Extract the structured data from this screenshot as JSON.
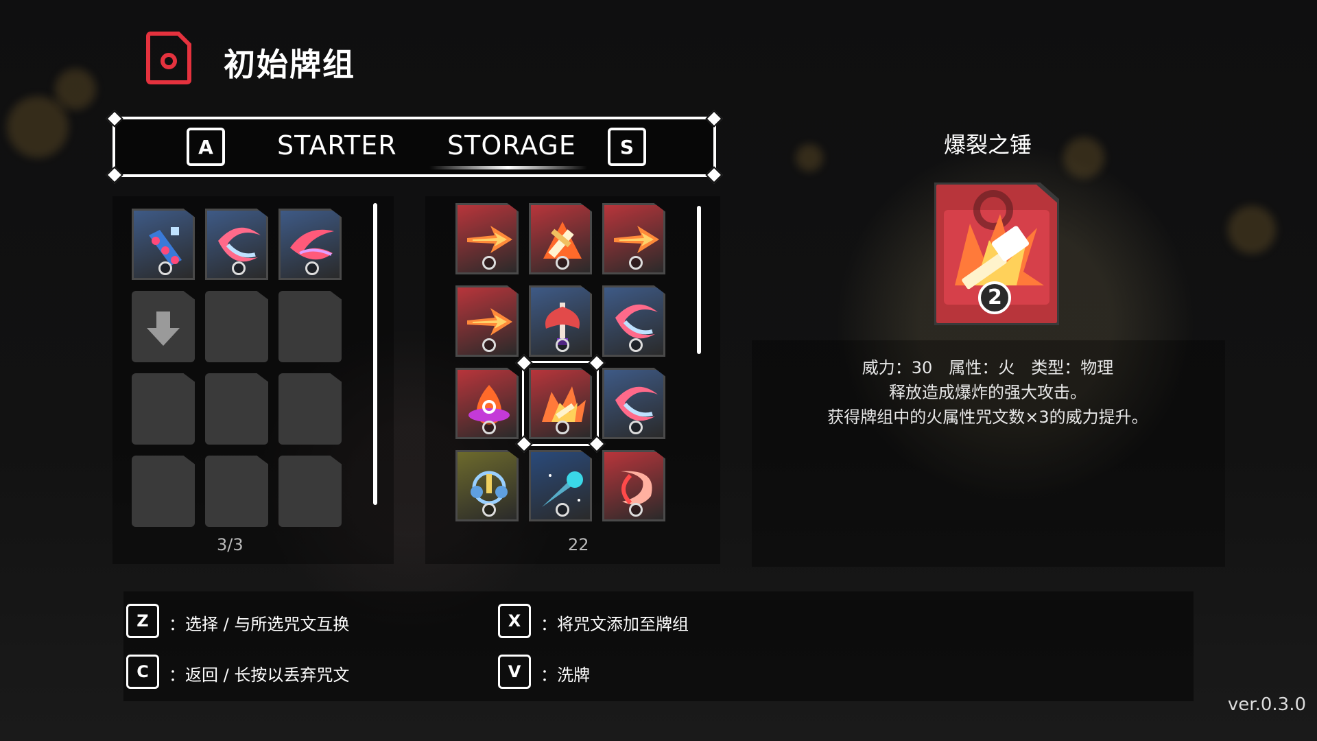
{
  "header": {
    "title": "初始牌组",
    "icon": "card-deck-icon"
  },
  "tabs": {
    "left_key": "A",
    "right_key": "S",
    "items": [
      {
        "label": "STARTER",
        "active": false
      },
      {
        "label": "STORAGE",
        "active": true
      }
    ]
  },
  "deck": {
    "count": "3/3",
    "cards": [
      {
        "icon": "blue-chain-spell-icon",
        "element": "ice"
      },
      {
        "icon": "blue-crescent-slash-icon",
        "element": "ice"
      },
      {
        "icon": "blue-claw-slash-icon",
        "element": "ice"
      }
    ],
    "drop_slot_icon": "down-arrow-icon",
    "empty_slots": 8
  },
  "storage": {
    "count": "22",
    "cards": [
      {
        "icon": "fire-arrow-icon",
        "element": "fire"
      },
      {
        "icon": "fire-sword-burst-icon",
        "element": "fire"
      },
      {
        "icon": "fire-arrow-icon",
        "element": "fire"
      },
      {
        "icon": "fire-arrow-icon",
        "element": "fire"
      },
      {
        "icon": "battle-axe-icon",
        "element": "ice"
      },
      {
        "icon": "blue-crescent-slash-icon",
        "element": "ice"
      },
      {
        "icon": "fire-flame-ring-icon",
        "element": "fire"
      },
      {
        "icon": "fire-hammer-burst-icon",
        "element": "fire"
      },
      {
        "icon": "blue-crescent-slash-icon",
        "element": "ice"
      },
      {
        "icon": "gear-orbit-icon",
        "element": "gold"
      },
      {
        "icon": "comet-icon",
        "element": "cosmic"
      },
      {
        "icon": "red-crescent-icon",
        "element": "fire"
      }
    ],
    "selected_index": 7
  },
  "detail": {
    "name": "爆裂之锤",
    "card_icon": "fire-hammer-burst-icon",
    "card_badge": "2",
    "stats_line": "威力：30　属性：火　类型：物理",
    "desc_line1": "释放造成爆炸的强大攻击。",
    "desc_line2": "获得牌组中的火属性咒文数×3的威力提升。"
  },
  "controls": [
    {
      "key": "Z",
      "label": "：选择 / 与所选咒文互换"
    },
    {
      "key": "X",
      "label": "：将咒文添加至牌组"
    },
    {
      "key": "C",
      "label": "：返回 / 长按以丢弃咒文"
    },
    {
      "key": "V",
      "label": "：洗牌"
    }
  ],
  "version": "ver.0.3.0",
  "colors": {
    "fire": "#b8353b",
    "ice": "#3e5a86",
    "gold": "#6d6a2c",
    "cosmic": "#2a4a7a",
    "accent_red": "#e5323e"
  }
}
